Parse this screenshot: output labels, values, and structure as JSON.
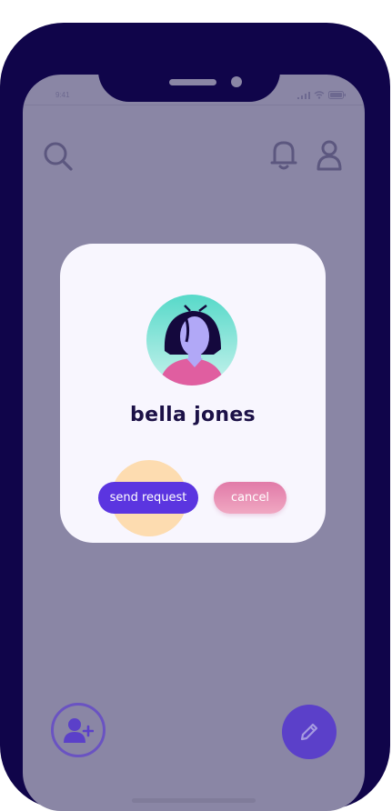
{
  "status_bar": {
    "time": "9:41",
    "icons": [
      "signal-icon",
      "wifi-icon",
      "battery-icon"
    ]
  },
  "header": {
    "icons": [
      "search-icon",
      "bell-icon",
      "user-icon"
    ]
  },
  "modal": {
    "user_name": "bella jones",
    "avatar": "avatar-woman-dark-hair",
    "send_label": "send request",
    "cancel_label": "cancel"
  },
  "bottom": {
    "icons": [
      "add-user-icon",
      "pencil-icon"
    ]
  },
  "colors": {
    "frame": "#10054a",
    "backdrop": "#8a86a5",
    "primary": "#5b35e0",
    "cancel": "#e17aa8",
    "highlight": "#fddcb0",
    "avatar_bg": "#6fe0d2",
    "title": "#1c1147"
  }
}
